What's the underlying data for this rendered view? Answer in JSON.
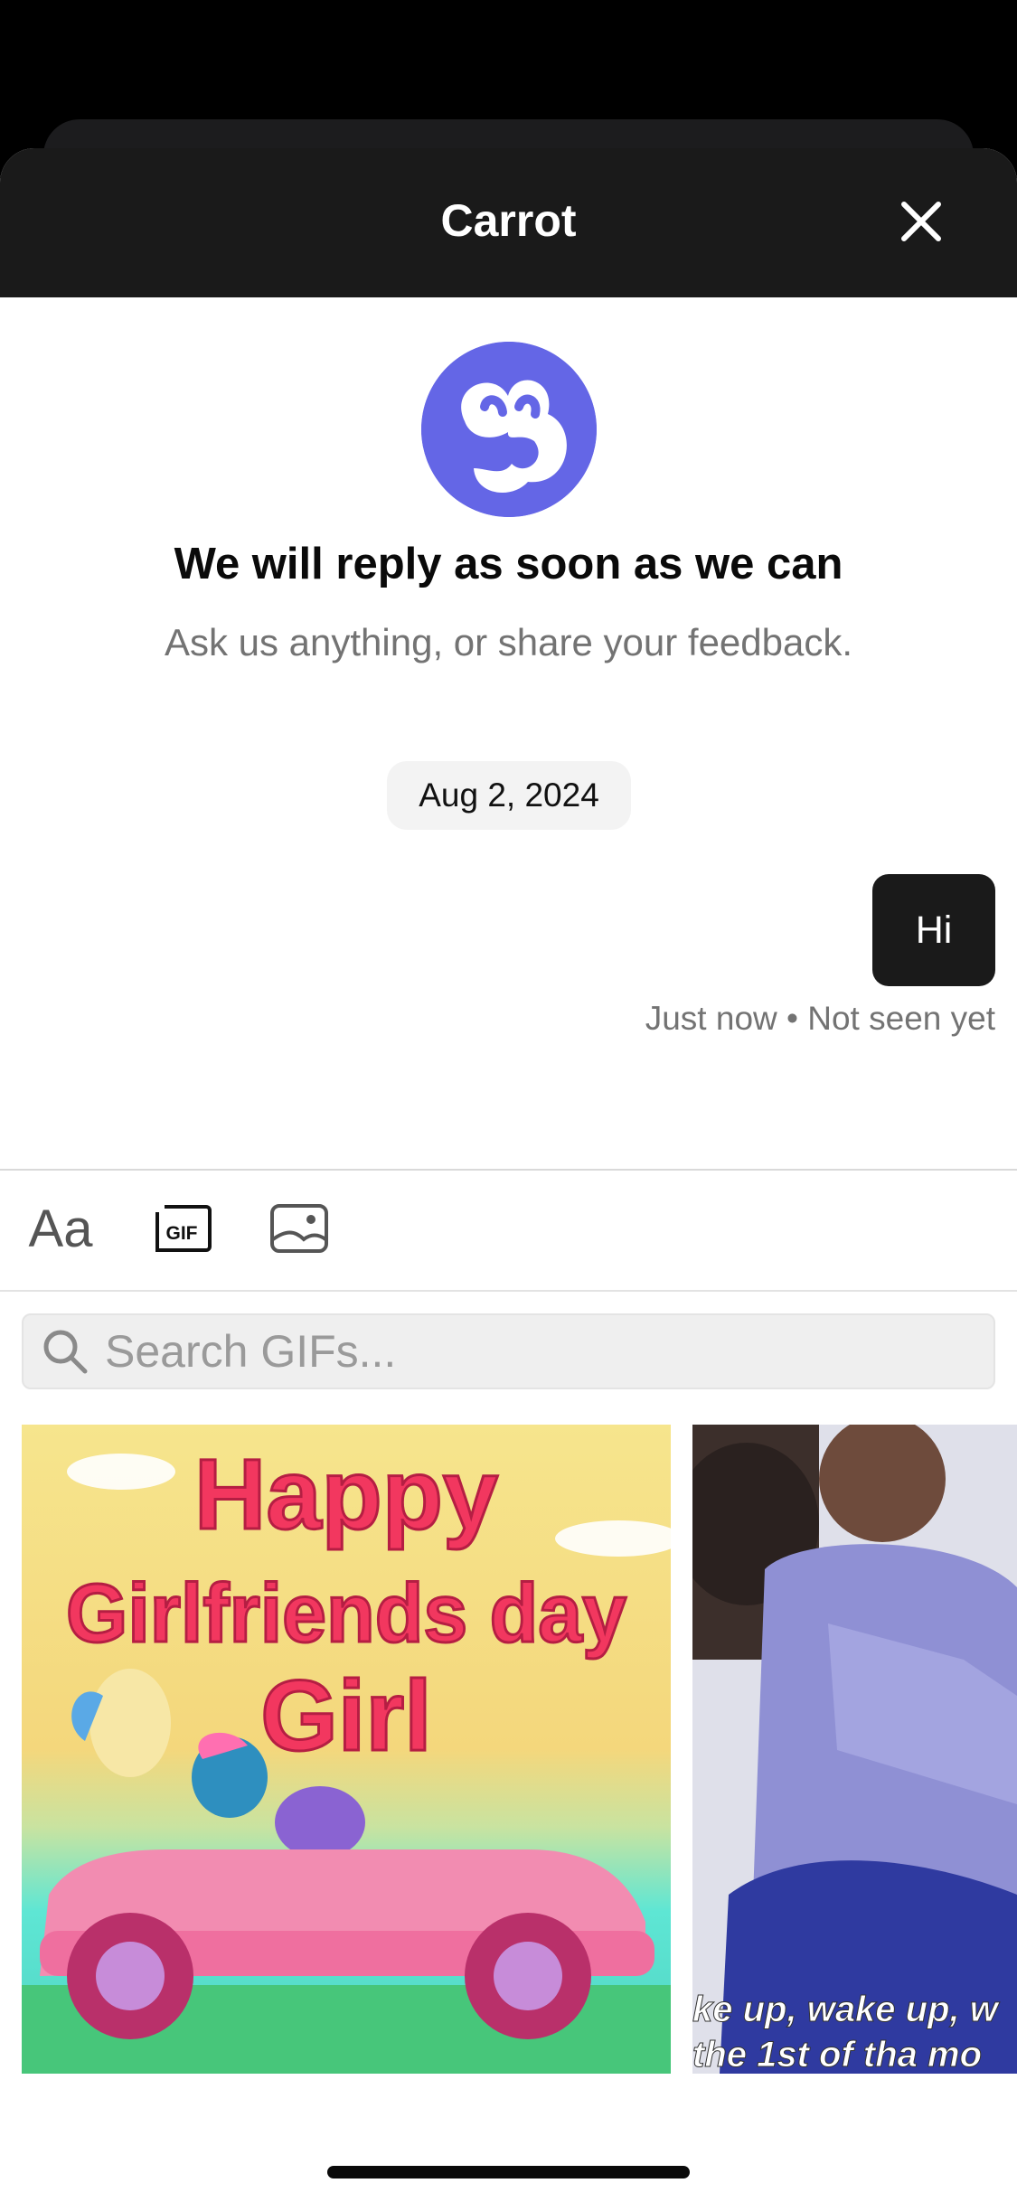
{
  "header": {
    "title": "Carrot"
  },
  "intro": {
    "title": "We will reply as soon as we can",
    "subtitle": "Ask us anything, or share your feedback."
  },
  "conversation": {
    "date": "Aug 2, 2024",
    "messages": [
      {
        "text": "Hi",
        "status": "Just now • Not seen yet"
      }
    ]
  },
  "composer": {
    "text_tool_label": "Aa",
    "gif_tool_label": "GIF"
  },
  "gif_search": {
    "placeholder": "Search GIFs...",
    "results": [
      {
        "caption_lines": [
          "Happy",
          "Girlfriends day",
          "Girl"
        ]
      },
      {
        "caption_lines": [
          "ke up, wake up, w",
          "the 1st of tha mo"
        ]
      }
    ]
  },
  "colors": {
    "brand": "#6466e6",
    "header_bg": "#1a1a1a",
    "bubble_bg": "#1a1a1a"
  },
  "icons": [
    "close-icon",
    "brand-logo",
    "gif-icon",
    "image-icon",
    "search-icon"
  ]
}
